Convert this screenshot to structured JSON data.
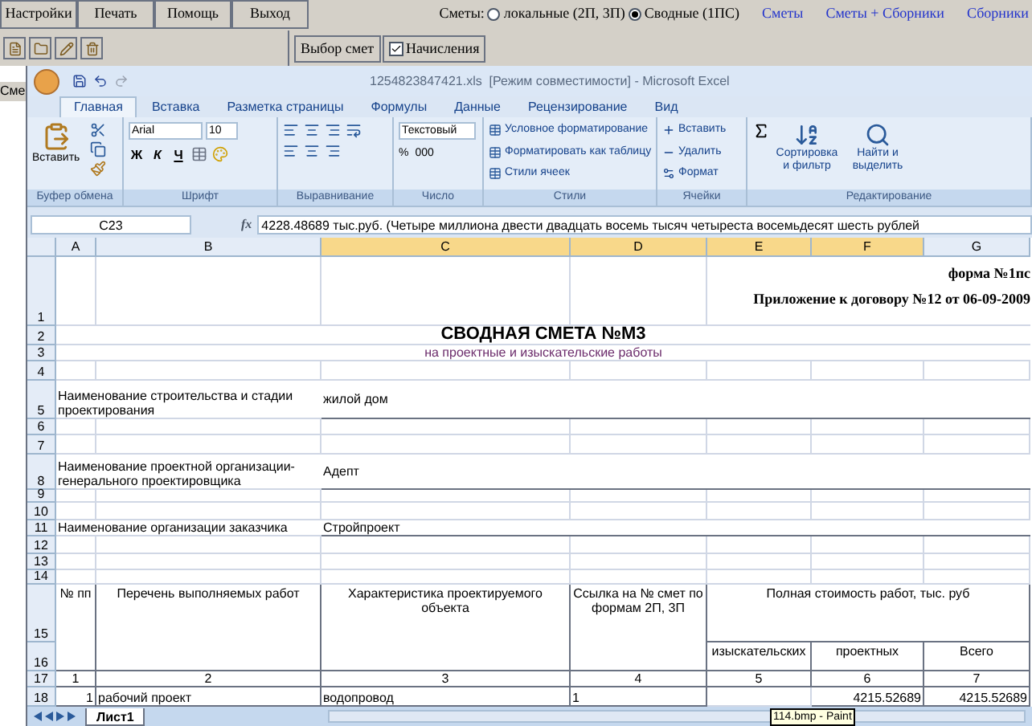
{
  "app": {
    "menu": [
      "Настройки",
      "Печать",
      "Помощь",
      "Выход"
    ],
    "estimate_type": {
      "label": "Сметы:",
      "options": [
        {
          "label": "локальные (2П, 3П)",
          "selected": false
        },
        {
          "label": "Сводные (1ПС)",
          "selected": true
        }
      ]
    },
    "links": [
      "Сметы",
      "Сметы + Сборники",
      "Сборники"
    ],
    "tabs": [
      {
        "label": "Выбор смет",
        "checked": false
      },
      {
        "label": "Начисления",
        "checked": true
      }
    ],
    "side_label": "Сме"
  },
  "excel": {
    "title": "1254823847421.xls  [Режим совместимости] - Microsoft Excel",
    "ribbon_tabs": [
      {
        "label": "Главная",
        "selected": true
      },
      {
        "label": "Вставка",
        "selected": false
      },
      {
        "label": "Разметка страницы",
        "selected": false
      },
      {
        "label": "Формулы",
        "selected": false
      },
      {
        "label": "Данные",
        "selected": false
      },
      {
        "label": "Рецензирование",
        "selected": false
      },
      {
        "label": "Вид",
        "selected": false
      }
    ],
    "groups": {
      "clipboard": {
        "paste": "Вставить",
        "label": "Буфер обмена"
      },
      "font": {
        "name": "Arial",
        "size": "10",
        "buttons": [
          "Ж",
          "К",
          "Ч"
        ],
        "label": "Шрифт"
      },
      "alignment": {
        "label": "Выравнивание"
      },
      "number": {
        "format": "Текстовый",
        "buttons": [
          "%",
          "000"
        ],
        "label": "Число"
      },
      "styles": {
        "items": [
          "Условное форматирование",
          "Форматировать как таблицу",
          "Стили ячеек"
        ],
        "label": "Стили"
      },
      "cells": {
        "items": [
          "Вставить",
          "Удалить",
          "Формат"
        ],
        "label": "Ячейки"
      },
      "editing": {
        "items": [
          "Сортировка и фильтр",
          "Найти и выделить"
        ],
        "label": "Редактирование"
      }
    },
    "formula_bar": {
      "cell": "C23",
      "fx": "fx",
      "value": "4228.48689 тыс.руб. (Четыре миллиона двести двадцать восемь тысяч четыреста восемьдесят шесть рублей"
    },
    "columns": [
      {
        "label": "A",
        "selected": false
      },
      {
        "label": "B",
        "selected": false
      },
      {
        "label": "C",
        "selected": true
      },
      {
        "label": "D",
        "selected": true
      },
      {
        "label": "E",
        "selected": true
      },
      {
        "label": "F",
        "selected": true
      },
      {
        "label": "G",
        "selected": false
      }
    ],
    "rows": [
      {
        "number": "1",
        "cells": [
          "",
          "",
          "",
          "",
          {
            "kind": "note",
            "lines": [
              "форма №1пс",
              "Приложение к договору №12 от 06-09-2009"
            ]
          }
        ]
      },
      {
        "number": "2",
        "cells": [
          {
            "kind": "title",
            "text": "СВОДНАЯ СМЕТА №М3"
          }
        ]
      },
      {
        "number": "3",
        "cells": [
          {
            "kind": "subtitle",
            "text": "на проектные и изыскательские работы"
          }
        ]
      },
      {
        "number": "4",
        "cells": []
      },
      {
        "number": "5",
        "cells": [
          {
            "kind": "label",
            "text": "Наименование строительства и стадии проектирования"
          },
          "",
          {
            "kind": "value",
            "text": "жилой дом"
          }
        ]
      },
      {
        "number": "6",
        "cells": []
      },
      {
        "number": "7",
        "cells": []
      },
      {
        "number": "8",
        "cells": [
          {
            "kind": "label",
            "text": "Наименование проектной организации-генерального проектировщика"
          },
          "",
          {
            "kind": "value",
            "text": "Адепт"
          }
        ]
      },
      {
        "number": "9",
        "cells": []
      },
      {
        "number": "10",
        "cells": []
      },
      {
        "number": "11",
        "cells": [
          {
            "kind": "label",
            "text": "Наименование организации заказчика"
          },
          "",
          {
            "kind": "value",
            "text": "Стройпроект"
          }
        ]
      },
      {
        "number": "12",
        "cells": []
      },
      {
        "number": "13",
        "cells": []
      },
      {
        "number": "14",
        "cells": []
      },
      {
        "number": "15",
        "cells": [
          {
            "kind": "header_tall",
            "text": "№ пп"
          },
          {
            "kind": "header_tall",
            "text": "Перечень выполняемых работ"
          },
          {
            "kind": "header_tall",
            "text": "Характеристика проектируемого объекта"
          },
          {
            "kind": "header_tall",
            "text": "Ссылка на № смет по формам 2П, 3П"
          },
          {
            "kind": "header_group",
            "text": "Полная стоимость работ, тыс. руб"
          }
        ]
      },
      {
        "number": "16",
        "cells": [
          "",
          "",
          "",
          "",
          {
            "kind": "header",
            "text": "изыскательских"
          },
          {
            "kind": "header",
            "text": "проектных"
          },
          {
            "kind": "header",
            "text": "Всего"
          }
        ]
      },
      {
        "number": "17",
        "cells": [
          {
            "kind": "index",
            "text": "1"
          },
          {
            "kind": "index",
            "text": "2"
          },
          {
            "kind": "index",
            "text": "3"
          },
          {
            "kind": "index",
            "text": "4"
          },
          {
            "kind": "index",
            "text": "5"
          },
          {
            "kind": "index",
            "text": "6"
          },
          {
            "kind": "index",
            "text": "7"
          }
        ]
      },
      {
        "number": "18",
        "cells": [
          {
            "kind": "number",
            "text": "1"
          },
          {
            "kind": "text",
            "text": "рабочий проект"
          },
          {
            "kind": "text",
            "text": "водопровод"
          },
          {
            "kind": "text",
            "text": "1"
          },
          "",
          {
            "kind": "number",
            "text": "4215.52689"
          },
          {
            "kind": "number",
            "text": "4215.52689"
          }
        ]
      }
    ],
    "sheet_tabs": [
      {
        "label": "Лист1",
        "selected": true
      }
    ],
    "tooltip": "114.bmp - Paint"
  }
}
